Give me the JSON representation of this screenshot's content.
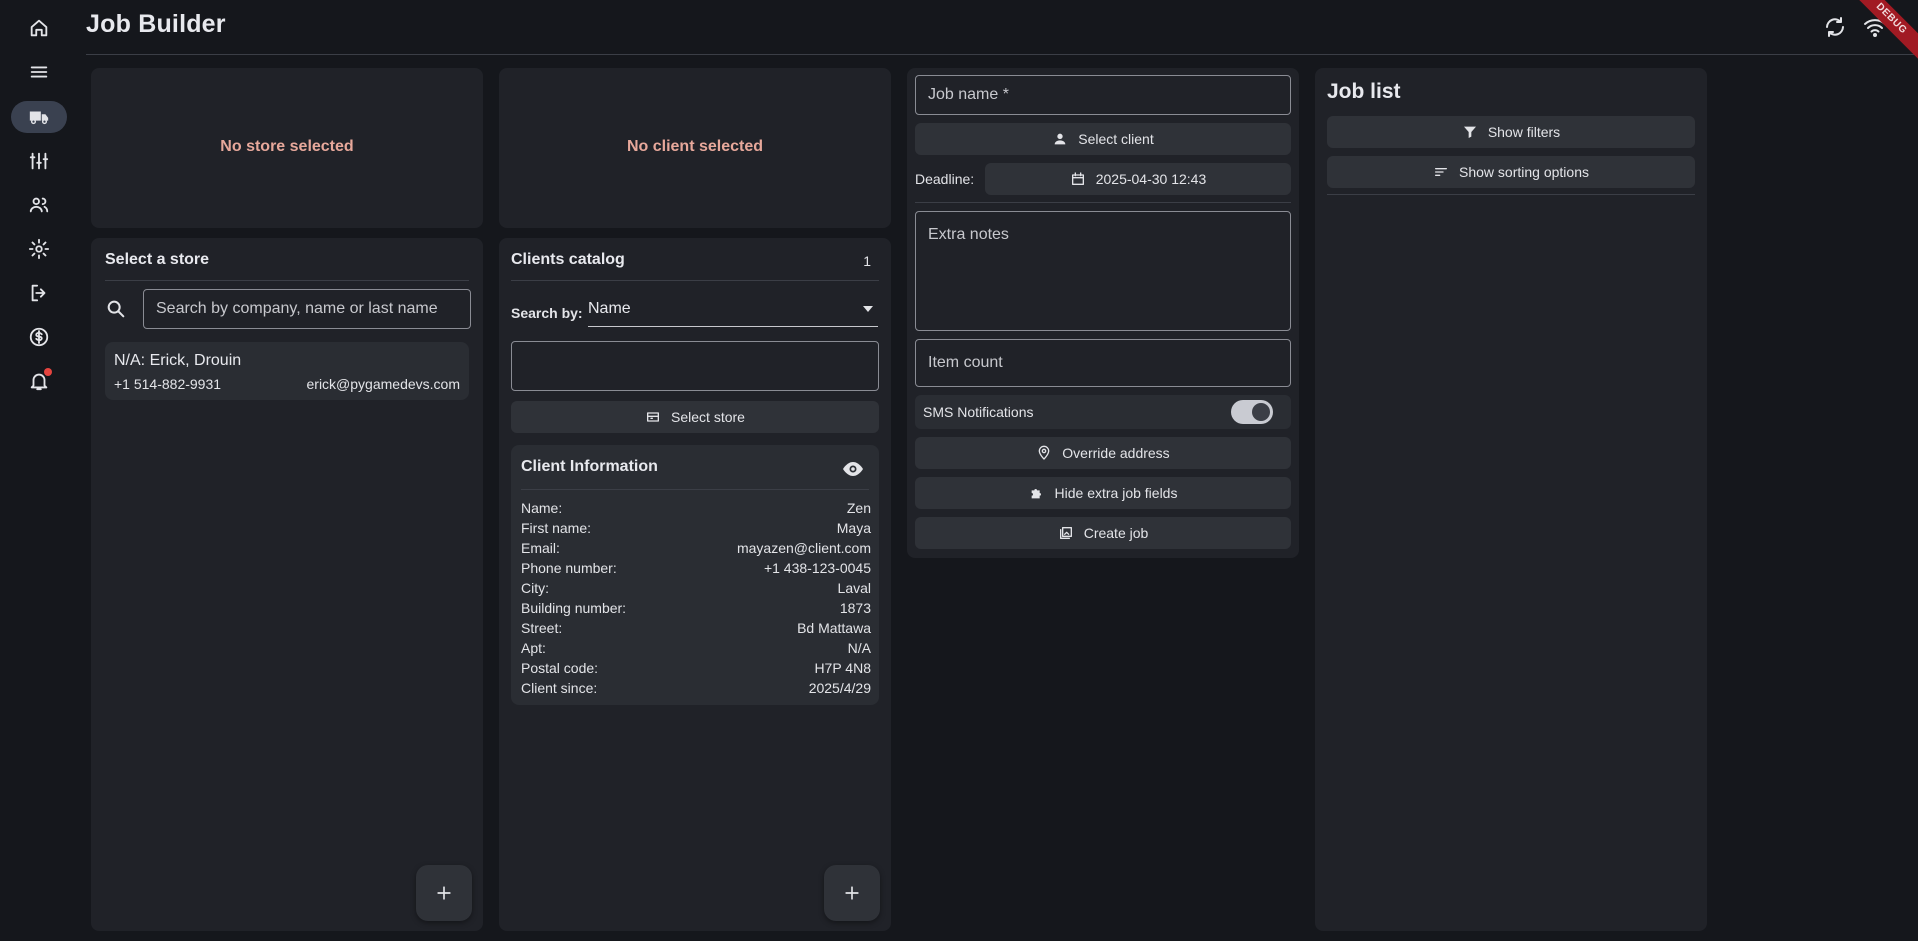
{
  "app": {
    "title": "Job Builder",
    "debug_label": "DEBUG"
  },
  "sidebar": {
    "items": [
      {
        "icon": "home-icon",
        "active": false
      },
      {
        "icon": "list-icon",
        "active": false
      },
      {
        "icon": "truck-icon",
        "active": true
      },
      {
        "icon": "tools-icon",
        "active": false
      },
      {
        "icon": "people-icon",
        "active": false
      },
      {
        "icon": "gear-icon",
        "active": false
      },
      {
        "icon": "logout-icon",
        "active": false
      },
      {
        "icon": "dollar-icon",
        "active": false
      },
      {
        "icon": "bell-icon",
        "active": false
      }
    ]
  },
  "store_panel": {
    "empty_text": "No store selected",
    "title": "Select a store",
    "search_placeholder": "Search by company, name or last name",
    "items": [
      {
        "name": "N/A: Erick, Drouin",
        "phone": "+1 514-882-9931",
        "email": "erick@pygamedevs.com"
      }
    ]
  },
  "client_panel": {
    "empty_text": "No client selected",
    "title": "Clients catalog",
    "count": "1",
    "search_by_label": "Search by:",
    "search_by_value": "Name",
    "select_store_label": "Select store",
    "info": {
      "title": "Client Information",
      "rows": [
        {
          "label": "Name:",
          "value": "Zen"
        },
        {
          "label": "First name:",
          "value": "Maya"
        },
        {
          "label": "Email:",
          "value": "mayazen@client.com"
        },
        {
          "label": "Phone number:",
          "value": "+1 438-123-0045"
        },
        {
          "label": "City:",
          "value": "Laval"
        },
        {
          "label": "Building number:",
          "value": "1873"
        },
        {
          "label": "Street:",
          "value": "Bd Mattawa"
        },
        {
          "label": "Apt:",
          "value": "N/A"
        },
        {
          "label": "Postal code:",
          "value": "H7P 4N8"
        },
        {
          "label": "Client since:",
          "value": "2025/4/29"
        }
      ]
    }
  },
  "job_form": {
    "job_name_placeholder": "Job name *",
    "select_client_label": "Select client",
    "deadline_label": "Deadline:",
    "deadline_value": "2025-04-30 12:43",
    "extra_notes_placeholder": "Extra notes",
    "item_count_placeholder": "Item count",
    "sms_label": "SMS Notifications",
    "sms_enabled": true,
    "override_address_label": "Override address",
    "hide_fields_label": "Hide extra job fields",
    "create_job_label": "Create job"
  },
  "job_list": {
    "title": "Job list",
    "show_filters_label": "Show filters",
    "show_sorting_label": "Show sorting options"
  },
  "colors": {
    "background": "#15171c",
    "card": "#202228",
    "button": "#2f3238",
    "empty_text": "#e7a89b",
    "debug_banner": "#a11a23"
  }
}
